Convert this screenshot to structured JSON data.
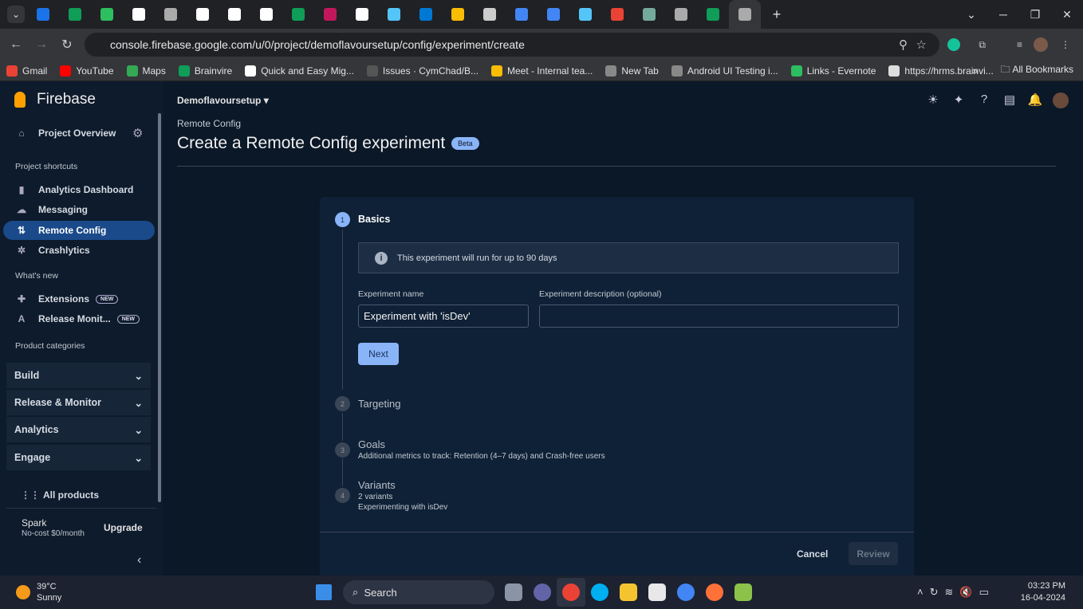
{
  "browser": {
    "url": "console.firebase.google.com/u/0/project/demoflavoursetup/config/experiment/create",
    "bookmarks": [
      "Gmail",
      "YouTube",
      "Maps",
      "Brainvire",
      "Quick and Easy Mig...",
      "Issues · CymChad/B...",
      "Meet - Internal tea...",
      "New Tab",
      "Android UI Testing i...",
      "Links - Evernote",
      "https://hrms.brainvi..."
    ],
    "all_bookmarks": "All Bookmarks",
    "tab_colors": [
      "#1a73e8",
      "#0f9d58",
      "#2dbe60",
      "#ffffff",
      "#aaaaaa",
      "#ffffff",
      "#ffffff",
      "#ffffff",
      "#0f9d58",
      "#c2185b",
      "#ffffff",
      "#54c5f8",
      "#0078d4",
      "#fbbc04",
      "#cccccc",
      "#4285f4",
      "#4285f4",
      "#54c5f8",
      "#ea4335",
      "#74aa9c",
      "#aaaaaa",
      "#0f9d58",
      "#aaaaaa"
    ]
  },
  "sidebar": {
    "brand": "Firebase",
    "overview": "Project Overview",
    "shortcuts_heading": "Project shortcuts",
    "shortcuts": [
      "Analytics Dashboard",
      "Messaging",
      "Remote Config",
      "Crashlytics"
    ],
    "whats_new_heading": "What's new",
    "new_items": [
      "Extensions",
      "Release Monit..."
    ],
    "new_badge": "NEW",
    "categories_heading": "Product categories",
    "categories": [
      "Build",
      "Release & Monitor",
      "Analytics",
      "Engage"
    ],
    "all_products": "All products",
    "plan": "Spark",
    "plan_desc": "No-cost $0/month",
    "upgrade": "Upgrade"
  },
  "header": {
    "project": "Demoflavoursetup",
    "breadcrumb": "Remote Config",
    "title": "Create a Remote Config experiment",
    "badge": "Beta"
  },
  "wizard": {
    "steps": [
      {
        "num": "1",
        "title": "Basics"
      },
      {
        "num": "2",
        "title": "Targeting"
      },
      {
        "num": "3",
        "title": "Goals",
        "sub": "Additional metrics to track: Retention (4–7 days) and Crash-free users"
      },
      {
        "num": "4",
        "title": "Variants",
        "sub": "2 variants",
        "sub2": "Experimenting with isDev"
      }
    ],
    "info": "This experiment will run for up to 90 days",
    "name_label": "Experiment name",
    "name_value": "Experiment with 'isDev'",
    "desc_label": "Experiment description (optional)",
    "desc_value": "",
    "next": "Next",
    "cancel": "Cancel",
    "review": "Review"
  },
  "taskbar": {
    "temp": "39°C",
    "weather": "Sunny",
    "search": "Search",
    "time": "03:23 PM",
    "date": "16-04-2024"
  }
}
